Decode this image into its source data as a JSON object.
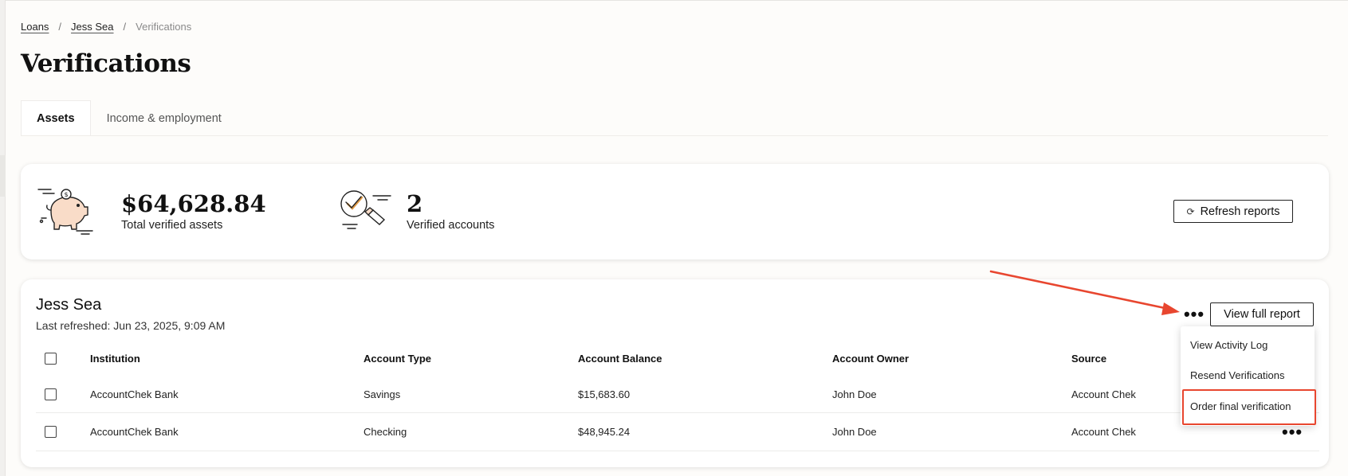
{
  "breadcrumb": {
    "items": [
      "Loans",
      "Jess Sea"
    ],
    "separator": "/",
    "current": "Verifications"
  },
  "page": {
    "title": "Verifications"
  },
  "tabs": [
    {
      "label": "Assets",
      "active": true
    },
    {
      "label": "Income & employment",
      "active": false
    }
  ],
  "summary": {
    "total_assets_value": "$64,628.84",
    "total_assets_label": "Total verified assets",
    "verified_accounts_value": "2",
    "verified_accounts_label": "Verified accounts",
    "refresh_button": "Refresh reports"
  },
  "account_group": {
    "owner_name": "Jess Sea",
    "last_refreshed": "Last refreshed: Jun 23, 2025, 9:09 AM",
    "more_icon": "more-horizontal-icon",
    "view_full_report": "View full report",
    "columns": [
      "Institution",
      "Account Type",
      "Account Balance",
      "Account Owner",
      "Source"
    ],
    "rows": [
      {
        "institution": "AccountChek Bank",
        "type": "Savings",
        "balance": "$15,683.60",
        "owner": "John Doe",
        "source": "Account Chek"
      },
      {
        "institution": "AccountChek Bank",
        "type": "Checking",
        "balance": "$48,945.24",
        "owner": "John Doe",
        "source": "Account Chek"
      }
    ]
  },
  "dropdown": {
    "items": [
      "View Activity Log",
      "Resend Verifications",
      "Order final verification"
    ]
  },
  "colors": {
    "annotation": "#e8462f",
    "piggy_fill": "#f9dcc8"
  }
}
